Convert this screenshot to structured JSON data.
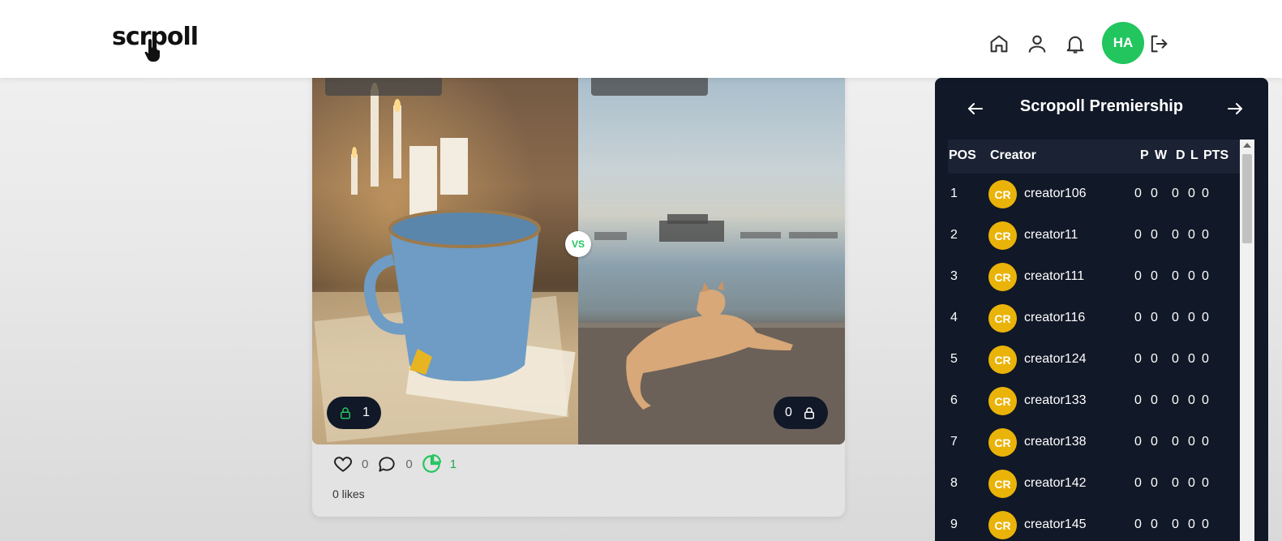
{
  "header": {
    "logo": "scrpoll",
    "avatar_initials": "HA",
    "icons": [
      "home-icon",
      "user-icon",
      "bell-icon",
      "logout-icon"
    ]
  },
  "post": {
    "vs_label": "VS",
    "left_votes": "1",
    "right_votes": "0",
    "likes_count": "0",
    "comments_count": "0",
    "polls_count": "1",
    "likes_text": "0 likes"
  },
  "premiership": {
    "title": "Scropoll Premiership",
    "columns": {
      "pos": "POS",
      "creator": "Creator",
      "p": "P",
      "w": "W",
      "d": "D",
      "l": "L",
      "pts": "PTS"
    },
    "badge": "CR",
    "rows": [
      {
        "pos": "1",
        "name": "creator106",
        "p": "0",
        "w": "0",
        "d": "0",
        "l": "0",
        "pts": "0"
      },
      {
        "pos": "2",
        "name": "creator11",
        "p": "0",
        "w": "0",
        "d": "0",
        "l": "0",
        "pts": "0"
      },
      {
        "pos": "3",
        "name": "creator111",
        "p": "0",
        "w": "0",
        "d": "0",
        "l": "0",
        "pts": "0"
      },
      {
        "pos": "4",
        "name": "creator116",
        "p": "0",
        "w": "0",
        "d": "0",
        "l": "0",
        "pts": "0"
      },
      {
        "pos": "5",
        "name": "creator124",
        "p": "0",
        "w": "0",
        "d": "0",
        "l": "0",
        "pts": "0"
      },
      {
        "pos": "6",
        "name": "creator133",
        "p": "0",
        "w": "0",
        "d": "0",
        "l": "0",
        "pts": "0"
      },
      {
        "pos": "7",
        "name": "creator138",
        "p": "0",
        "w": "0",
        "d": "0",
        "l": "0",
        "pts": "0"
      },
      {
        "pos": "8",
        "name": "creator142",
        "p": "0",
        "w": "0",
        "d": "0",
        "l": "0",
        "pts": "0"
      },
      {
        "pos": "9",
        "name": "creator145",
        "p": "0",
        "w": "0",
        "d": "0",
        "l": "0",
        "pts": "0"
      }
    ]
  },
  "colors": {
    "accent_green": "#22c55e",
    "panel_bg": "#111827",
    "badge_yellow": "#eab308"
  }
}
